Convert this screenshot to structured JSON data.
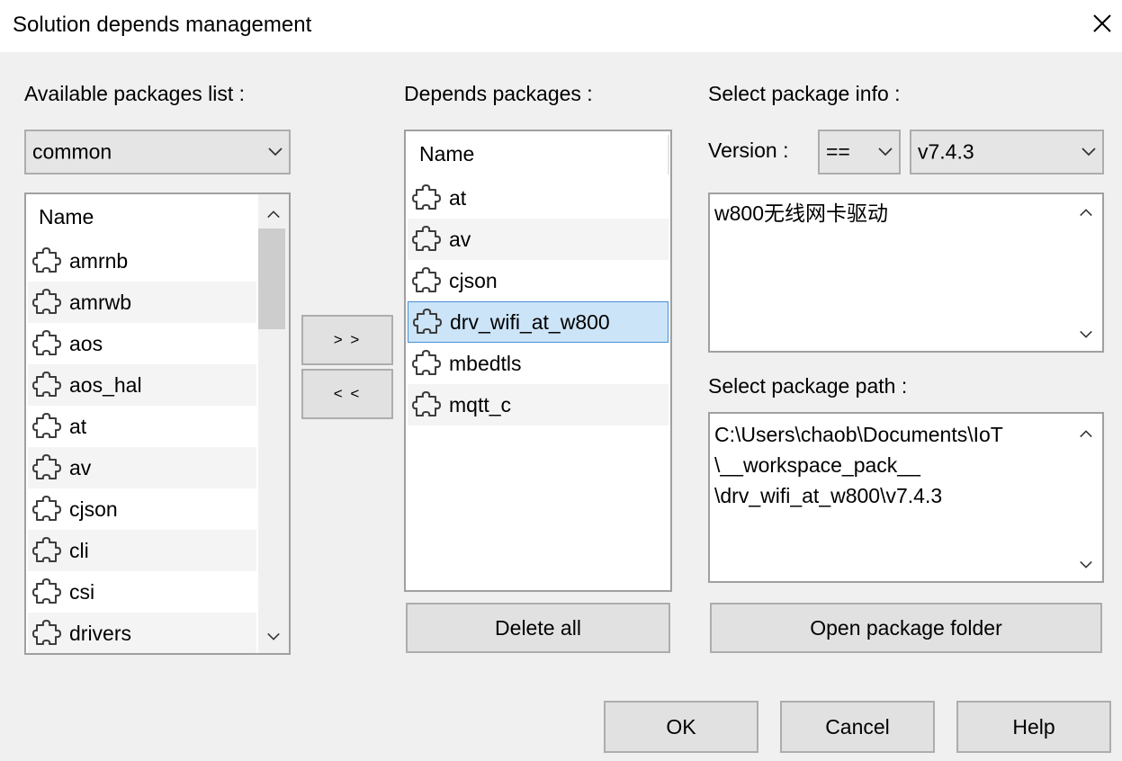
{
  "window": {
    "title": "Solution depends management",
    "close_icon": "close-icon"
  },
  "available": {
    "label": "Available packages list :",
    "filter_value": "common",
    "column_name": "Name",
    "items": [
      "amrnb",
      "amrwb",
      "aos",
      "aos_hal",
      "at",
      "av",
      "cjson",
      "cli",
      "csi",
      "drivers"
    ]
  },
  "transfer": {
    "add_label": "> >",
    "remove_label": "< <"
  },
  "depends": {
    "label": "Depends packages :",
    "column_name": "Name",
    "items": [
      "at",
      "av",
      "cjson",
      "drv_wifi_at_w800",
      "mbedtls",
      "mqtt_c"
    ],
    "selected": "drv_wifi_at_w800",
    "delete_all_label": "Delete all"
  },
  "info": {
    "label": "Select package info :",
    "version_label": "Version :",
    "operator_value": "==",
    "version_value": "v7.4.3",
    "description": "w800无线网卡驱动",
    "path_label": "Select package path :",
    "path_lines": [
      "C:\\Users\\chaob\\Documents\\IoT",
      "\\__workspace_pack__",
      "\\drv_wifi_at_w800\\v7.4.3"
    ],
    "open_folder_label": "Open package folder"
  },
  "footer": {
    "ok_label": "OK",
    "cancel_label": "Cancel",
    "help_label": "Help"
  },
  "colors": {
    "selection_bg": "#cce4f7",
    "selection_border": "#4a90d6",
    "dialog_bg": "#f0f0f0"
  }
}
